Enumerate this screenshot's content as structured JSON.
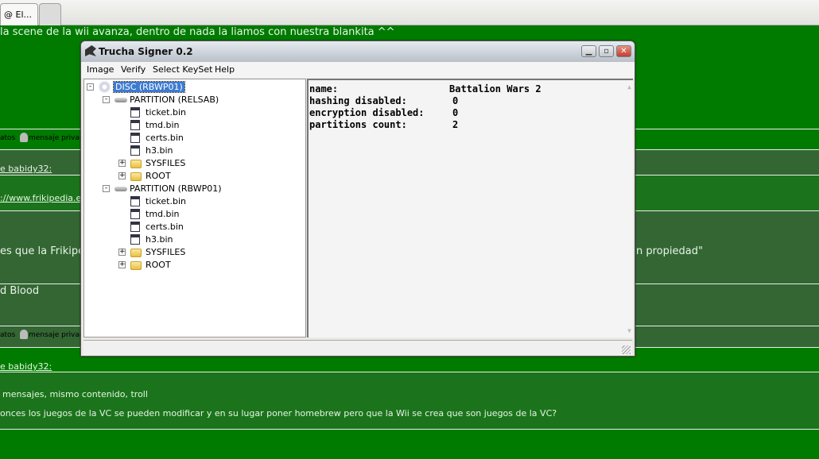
{
  "browser": {
    "tabs": [
      {
        "label": "@ El..."
      },
      {
        "label": ""
      }
    ]
  },
  "forum": {
    "line1": "la scene de la wii avanza, dentro de nada la liamos con nuestra blankita ^^",
    "user_bar1_datos": "atos",
    "user_bar1_pm": "mensaje privad",
    "quote1": "e babidy32:",
    "link": "://www.frikipedia.e",
    "text_frikipe": "es que la Frikipe",
    "text_propiedad": "n propiedad\"",
    "text_blood": "d Blood",
    "user_bar2_datos": "atos",
    "user_bar2_pm": "mensaje privad",
    "quote2": "e babidy32:",
    "line_troll": "mensajes, mismo contenido, troll",
    "line_vc": "onces los juegos de la VC se pueden modificar y en su lugar poner homebrew pero que la Wii se crea que son juegos de la VC?"
  },
  "window": {
    "title": "Trucha Signer 0.2",
    "menu": [
      "Image",
      "Verify",
      "Select KeySet",
      "Help"
    ],
    "tree": {
      "disc": "DISC (RBWP01)",
      "partitions": [
        {
          "label": "PARTITION (RELSAB)",
          "files": [
            "ticket.bin",
            "tmd.bin",
            "certs.bin",
            "h3.bin"
          ],
          "folders": [
            "SYSFILES",
            "ROOT"
          ]
        },
        {
          "label": "PARTITION (RBWP01)",
          "files": [
            "ticket.bin",
            "tmd.bin",
            "certs.bin",
            "h3.bin"
          ],
          "folders": [
            "SYSFILES",
            "ROOT"
          ]
        }
      ]
    },
    "info": [
      {
        "key": "name:",
        "value": "Battalion Wars 2"
      },
      {
        "key": "hashing disabled:",
        "value": "0"
      },
      {
        "key": "encryption disabled:",
        "value": "0"
      },
      {
        "key": "partitions count:",
        "value": "2"
      }
    ]
  }
}
